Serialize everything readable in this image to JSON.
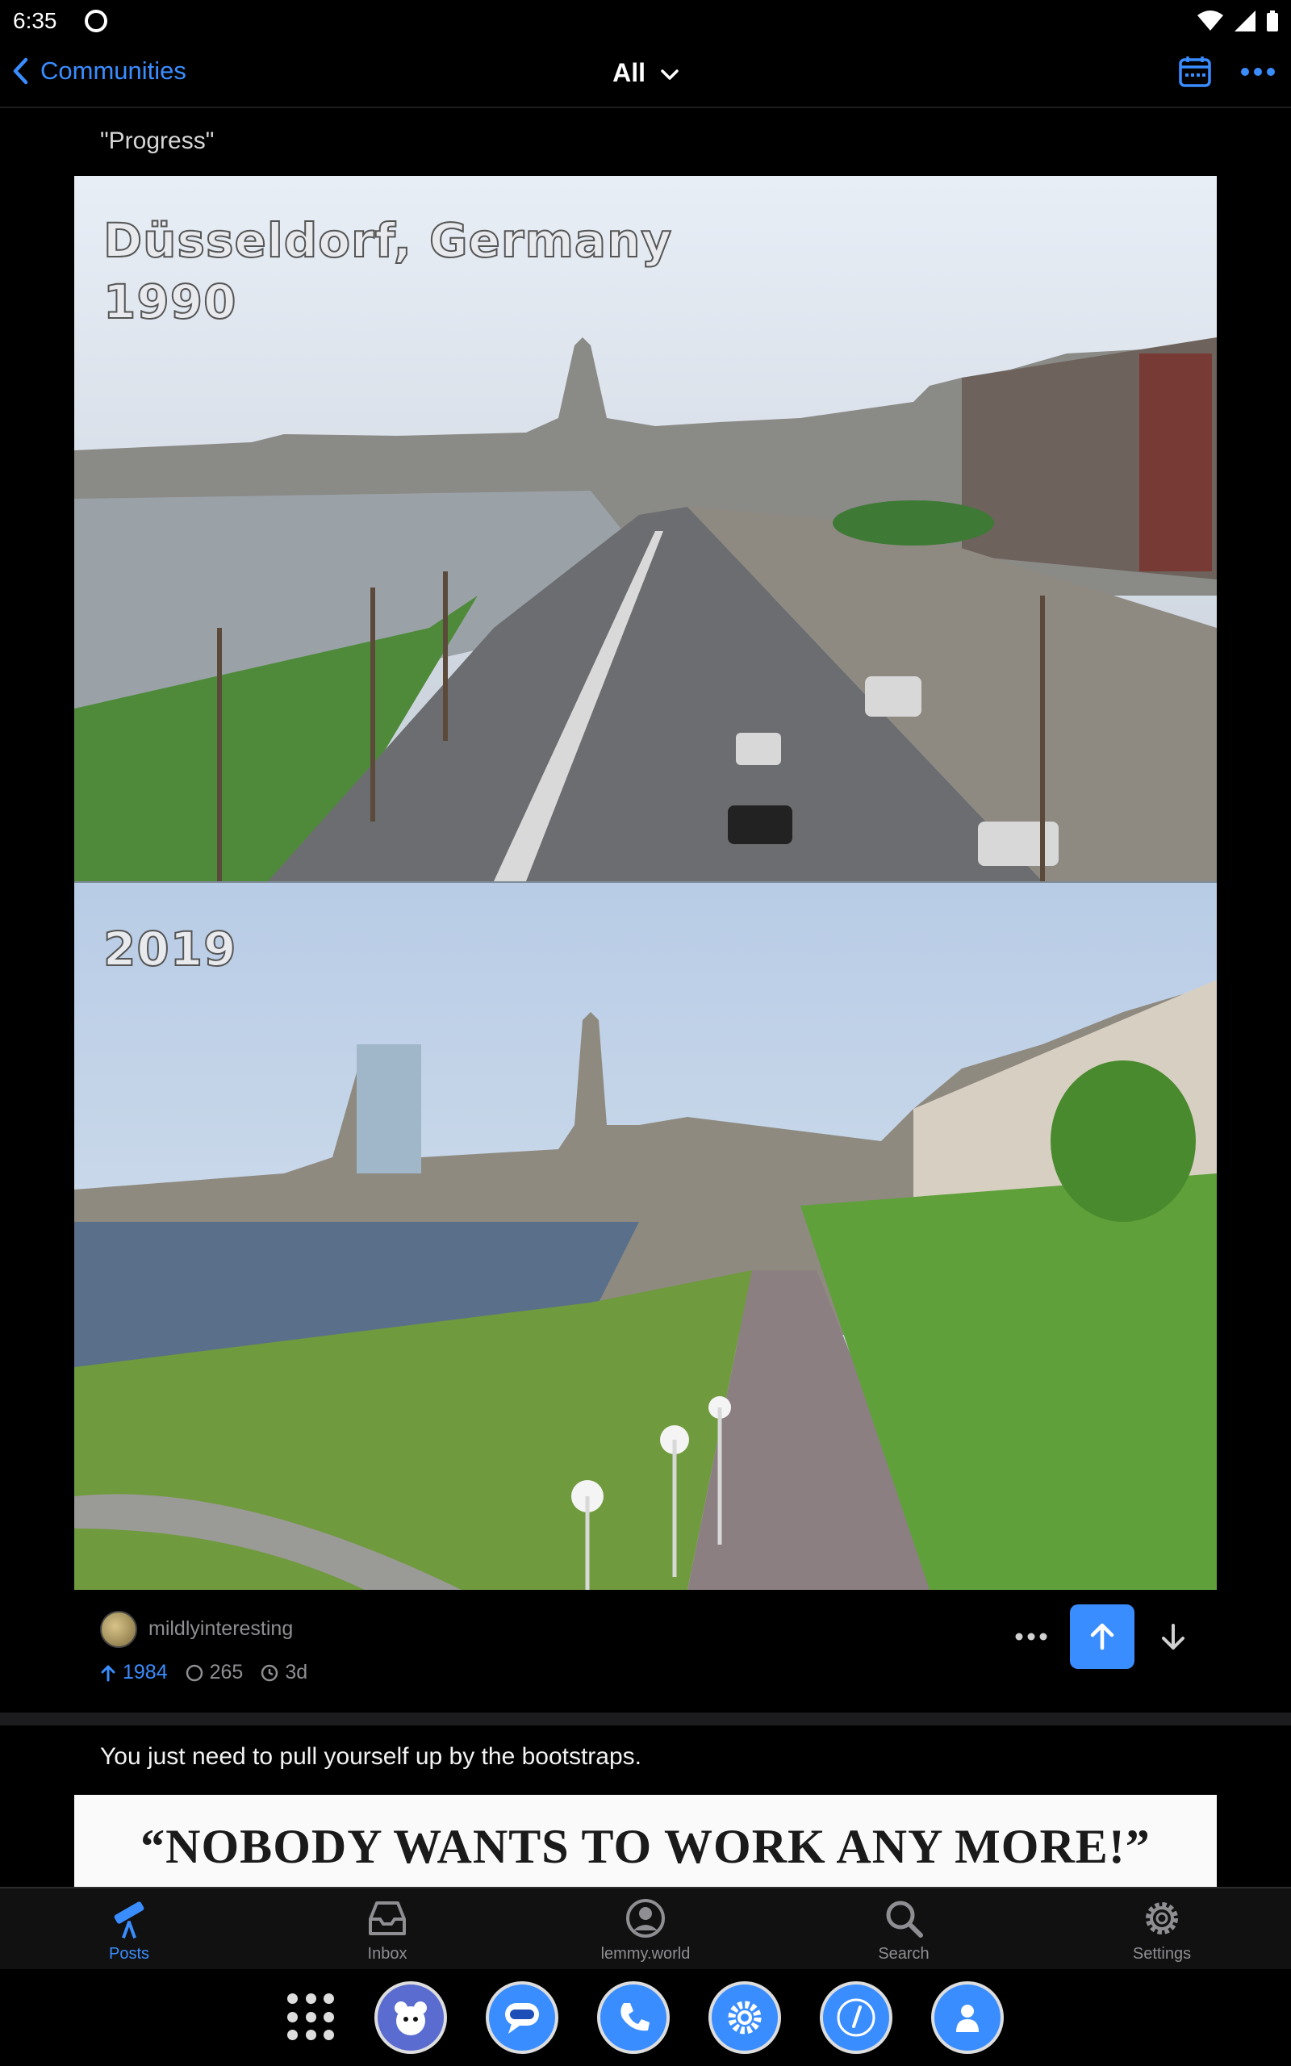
{
  "status_bar": {
    "time": "6:35"
  },
  "nav": {
    "back_label": "Communities",
    "feed_label": "All"
  },
  "posts": [
    {
      "title": "\"Progress\"",
      "image_text": {
        "top_line1": "Düsseldorf, Germany",
        "top_line2": "1990",
        "bottom": "2019"
      },
      "community": "mildlyinteresting",
      "score": "1984",
      "comments": "265",
      "age": "3d"
    },
    {
      "title": "You just need to pull yourself up by the bootstraps.",
      "image_text": "“NOBODY WANTS TO WORK ANY MORE!”"
    }
  ],
  "tabs": [
    {
      "label": "Posts",
      "icon": "telescope-icon",
      "active": true
    },
    {
      "label": "Inbox",
      "icon": "inbox-icon"
    },
    {
      "label": "lemmy.world",
      "icon": "account-icon"
    },
    {
      "label": "Search",
      "icon": "search-icon"
    },
    {
      "label": "Settings",
      "icon": "gear-icon"
    }
  ],
  "colors": {
    "accent": "#3a8dff",
    "background": "#000000",
    "secondary_text": "#8e8e93"
  }
}
